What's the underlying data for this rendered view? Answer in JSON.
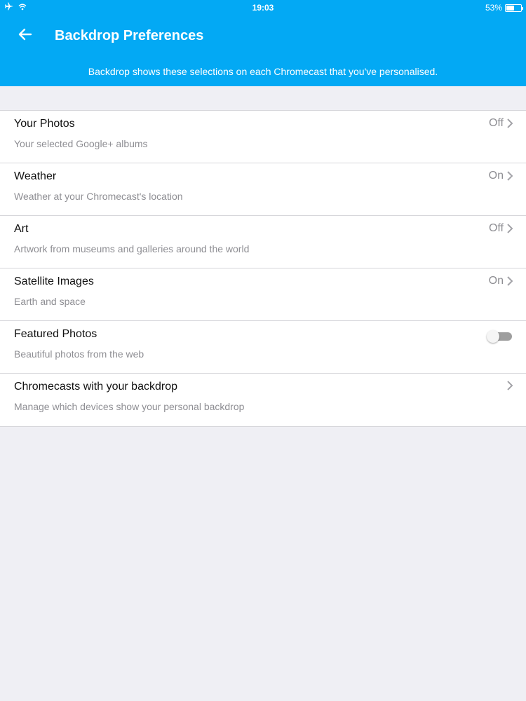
{
  "status_bar": {
    "time": "19:03",
    "battery_text": "53%",
    "battery_level": 0.53,
    "icons": [
      "airplane-icon",
      "wifi-icon",
      "battery-icon"
    ]
  },
  "header": {
    "title": "Backdrop Preferences",
    "subtitle": "Backdrop shows these selections on each Chromecast that you've personalised.",
    "back_icon": "back-arrow-icon",
    "color": "#03a9f4"
  },
  "preferences": [
    {
      "title": "Your Photos",
      "description": "Your selected Google+ albums",
      "value": "Off",
      "control": "chevron"
    },
    {
      "title": "Weather",
      "description": "Weather at your Chromecast's location",
      "value": "On",
      "control": "chevron"
    },
    {
      "title": "Art",
      "description": "Artwork from museums and galleries around the world",
      "value": "Off",
      "control": "chevron"
    },
    {
      "title": "Satellite Images",
      "description": "Earth and space",
      "value": "On",
      "control": "chevron"
    },
    {
      "title": "Featured Photos",
      "description": "Beautiful photos from the web",
      "value": "",
      "control": "toggle",
      "toggle_on": false
    },
    {
      "title": "Chromecasts with your backdrop",
      "description": "Manage which devices show your personal backdrop",
      "value": "",
      "control": "chevron"
    }
  ]
}
